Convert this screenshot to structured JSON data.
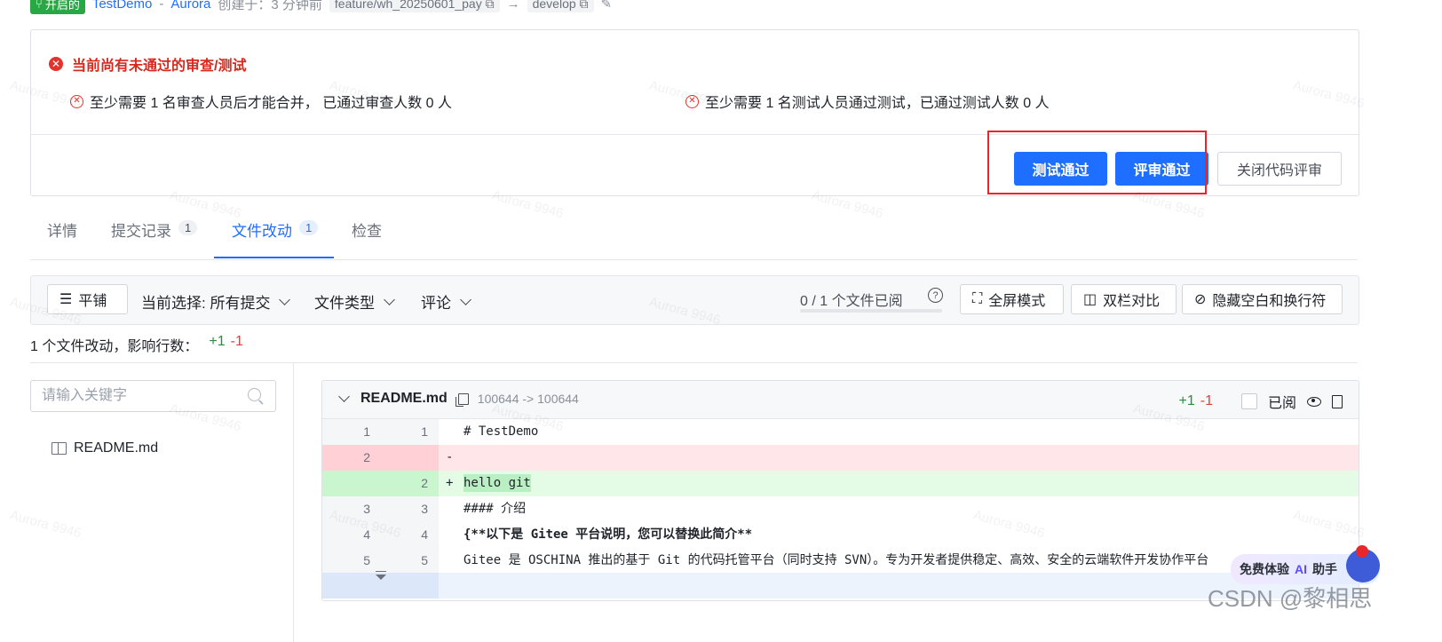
{
  "meta": {
    "status_badge": "开启的",
    "repo_link": "TestDemo",
    "sep": "-",
    "author": "Aurora",
    "created": "创建于：3 分钟前",
    "source_branch": "feature/wh_20250601_pay",
    "arrow": "→",
    "target_branch": "develop"
  },
  "review": {
    "title": "当前尚有未通过的审查/测试",
    "req_review": "至少需要 1 名审查人员后才能合并， 已通过审查人数 0 人",
    "req_test": "至少需要 1 名测试人员通过测试，已通过测试人数 0 人",
    "btn_test_pass": "测试通过",
    "btn_review_pass": "评审通过",
    "btn_close": "关闭代码评审"
  },
  "tabs": [
    {
      "label": "详情"
    },
    {
      "label": "提交记录",
      "count": "1"
    },
    {
      "label": "文件改动",
      "count": "1"
    },
    {
      "label": "检查"
    }
  ],
  "toolbar": {
    "tile": "平铺",
    "selection": "当前选择: 所有提交",
    "file_type": "文件类型",
    "comments": "评论",
    "viewed_progress": "0 / 1 个文件已阅",
    "viewed_fraction": 0,
    "help": "?",
    "fullscreen": "全屏模式",
    "side_by_side": "双栏对比",
    "hide_whitespace": "隐藏空白和换行符"
  },
  "summary": {
    "text": "1 个文件改动，影响行数：",
    "added": "+1",
    "removed": "-1"
  },
  "file_tree": {
    "search_placeholder": "请输入关键字",
    "files": [
      "README.md"
    ]
  },
  "diff": {
    "file_name": "README.md",
    "mode": "100644 -> 100644",
    "added": "+1",
    "removed": "-1",
    "viewed_label": "已阅",
    "lines": [
      {
        "type": "ctx",
        "old": "1",
        "new": "1",
        "marker": " ",
        "text": "# TestDemo"
      },
      {
        "type": "del",
        "old": "2",
        "new": "",
        "marker": "-",
        "text": ""
      },
      {
        "type": "add",
        "old": "",
        "new": "2",
        "marker": "+",
        "text": "hello git"
      },
      {
        "type": "ctx",
        "old": "3",
        "new": "3",
        "marker": " ",
        "text": "#### 介绍"
      },
      {
        "type": "ctx",
        "old": "4",
        "new": "4",
        "marker": " ",
        "text": "{**以下是 Gitee 平台说明，您可以替换此简介**"
      },
      {
        "type": "ctx",
        "old": "5",
        "new": "5",
        "marker": " ",
        "text": "Gitee 是 OSCHINA 推出的基于 Git 的代码托管平台（同时支持 SVN）。专为开发者提供稳定、高效、安全的云端软件开发协作平台"
      }
    ]
  },
  "ai_float": {
    "text": "免费体验",
    "ai": "AI",
    "suffix": "助手"
  },
  "watermark": "CSDN @黎相思"
}
